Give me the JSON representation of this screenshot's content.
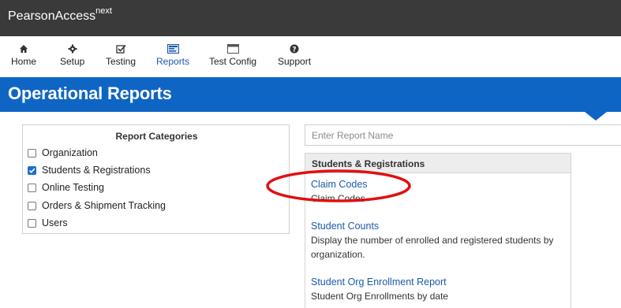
{
  "app": {
    "brand": "PearsonAccess",
    "brand_sup": "next"
  },
  "nav": [
    {
      "label": "Home",
      "icon": "home-icon"
    },
    {
      "label": "Setup",
      "icon": "gear-icon"
    },
    {
      "label": "Testing",
      "icon": "checkbox-icon"
    },
    {
      "label": "Reports",
      "icon": "reports-icon"
    },
    {
      "label": "Test Config",
      "icon": "window-icon"
    },
    {
      "label": "Support",
      "icon": "question-icon"
    }
  ],
  "page": {
    "title": "Operational Reports"
  },
  "categories": {
    "title": "Report Categories",
    "items": [
      {
        "label": "Organization",
        "checked": false
      },
      {
        "label": "Students & Registrations",
        "checked": true
      },
      {
        "label": "Online Testing",
        "checked": false
      },
      {
        "label": "Orders & Shipment Tracking",
        "checked": false
      },
      {
        "label": "Users",
        "checked": false
      }
    ]
  },
  "search": {
    "placeholder": "Enter Report Name"
  },
  "results": {
    "header": "Students & Registrations",
    "reports": [
      {
        "name": "Claim Codes",
        "description": "Claim Codes"
      },
      {
        "name": "Student Counts",
        "description": "Display the number of enrolled and registered students by organization."
      },
      {
        "name": "Student Org Enrollment Report",
        "description": "Student Org Enrollments by date"
      }
    ]
  },
  "colors": {
    "topbar": "#3a3a3a",
    "header": "#0f65c3",
    "link": "#1a5aa8",
    "annotation": "#e01010",
    "checkbox": "#1a6fd1"
  }
}
